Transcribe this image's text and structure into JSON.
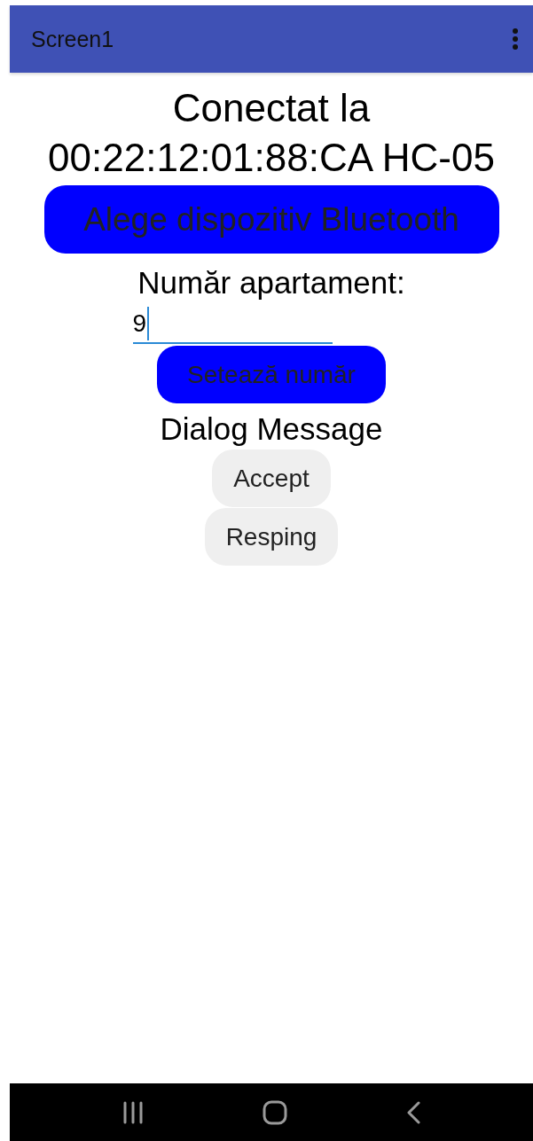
{
  "app_bar": {
    "title": "Screen1"
  },
  "status_text": "Conectat la 00:22:12:01:88:CA HC-05",
  "pick_button": {
    "label": "Alege dispozitiv Bluetooth"
  },
  "apartment": {
    "label": "Număr apartament:",
    "value": "9",
    "focused": true
  },
  "set_button": {
    "label": "Setează număr"
  },
  "dialog": {
    "message": "Dialog Message",
    "buttons": [
      "Accept",
      "Resping"
    ]
  }
}
